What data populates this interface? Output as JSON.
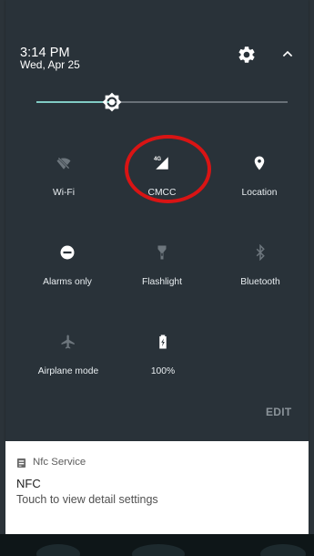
{
  "status": {
    "time": "3:14 PM",
    "date": "Wed, Apr 25"
  },
  "icons": {
    "settings": "gear-icon",
    "collapse": "chevron-up-icon",
    "brightness": "brightness-icon",
    "wifi": "wifi-off-icon",
    "cellular": "cellular-4g-icon",
    "location": "location-pin-icon",
    "alarms": "do-not-disturb-icon",
    "flashlight": "flashlight-icon",
    "bluetooth": "bluetooth-icon",
    "airplane": "airplane-icon",
    "battery": "battery-charging-icon",
    "notification_app": "nfc-service-icon"
  },
  "quick_settings": {
    "brightness_level": 0.3,
    "tiles": [
      {
        "label": "Wi-Fi",
        "icon": "wifi-off-icon",
        "active": false
      },
      {
        "label": "CMCC",
        "icon": "cellular-4g-icon",
        "badge": "4G",
        "active": true
      },
      {
        "label": "Location",
        "icon": "location-pin-icon",
        "active": true
      },
      {
        "label": "Alarms only",
        "icon": "do-not-disturb-icon",
        "active": true
      },
      {
        "label": "Flashlight",
        "icon": "flashlight-icon",
        "active": false
      },
      {
        "label": "Bluetooth",
        "icon": "bluetooth-icon",
        "active": false
      },
      {
        "label": "Airplane mode",
        "icon": "airplane-icon",
        "active": false
      },
      {
        "label": "100%",
        "icon": "battery-charging-icon",
        "active": true
      }
    ],
    "edit_label": "EDIT"
  },
  "notification": {
    "app_name": "Nfc Service",
    "title": "NFC",
    "body": "Touch to view detail settings"
  },
  "colors": {
    "panel": "#293239",
    "accent": "#80cbc4",
    "active_icon": "#ffffff",
    "inactive_icon": "#6d767d",
    "highlight": "#d91414"
  }
}
